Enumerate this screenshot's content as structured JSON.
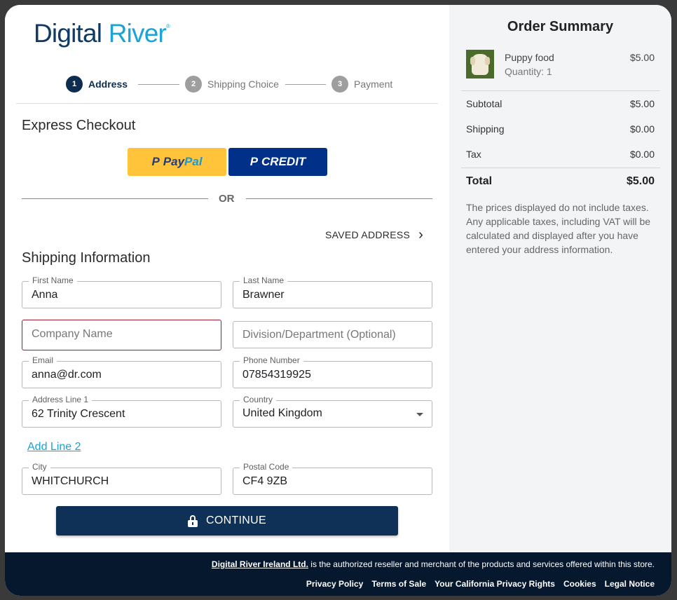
{
  "brand": {
    "logo_part1": "Digital",
    "logo_part2": "River",
    "logo_mark": "®"
  },
  "stepper": {
    "steps": [
      {
        "num": "1",
        "label": "Address"
      },
      {
        "num": "2",
        "label": "Shipping Choice"
      },
      {
        "num": "3",
        "label": "Payment"
      }
    ]
  },
  "express": {
    "title": "Express Checkout",
    "paypal_a": "Pay",
    "paypal_b": "Pal",
    "credit_label": "CREDIT",
    "pp_mark": "P",
    "or_text": "OR"
  },
  "saved_address": {
    "label": "SAVED ADDRESS",
    "chevron": "›"
  },
  "shipping": {
    "title": "Shipping Information",
    "first_name": {
      "label": "First Name",
      "value": "Anna"
    },
    "last_name": {
      "label": "Last Name",
      "value": "Brawner"
    },
    "company": {
      "placeholder": "Company Name"
    },
    "division": {
      "placeholder": "Division/Department (Optional)"
    },
    "email": {
      "label": "Email",
      "value": "anna@dr.com"
    },
    "phone": {
      "label": "Phone Number",
      "value": "07854319925"
    },
    "address1": {
      "label": "Address Line 1",
      "value": "62 Trinity Crescent"
    },
    "country": {
      "label": "Country",
      "value": "United Kingdom"
    },
    "add_line2": "Add Line 2",
    "city": {
      "label": "City",
      "value": "WHITCHURCH"
    },
    "postal": {
      "label": "Postal Code",
      "value": "CF4 9ZB"
    },
    "continue_label": "CONTINUE"
  },
  "summary": {
    "title": "Order Summary",
    "item": {
      "name": "Puppy food",
      "quantity": "Quantity: 1",
      "price": "$5.00"
    },
    "subtotal": {
      "label": "Subtotal",
      "value": "$5.00"
    },
    "shipping": {
      "label": "Shipping",
      "value": "$0.00"
    },
    "tax": {
      "label": "Tax",
      "value": "$0.00"
    },
    "total": {
      "label": "Total",
      "value": "$5.00"
    },
    "note": "The prices displayed do not include taxes. Any applicable taxes, including VAT will be calculated and displayed after you have entered your address information."
  },
  "footer": {
    "reseller_link": "Digital River Ireland Ltd.",
    "reseller_text": " is the authorized reseller and merchant of the products and services offered within this store.",
    "links": [
      "Privacy Policy",
      "Terms of Sale",
      "Your California Privacy Rights",
      "Cookies",
      "Legal Notice"
    ]
  }
}
